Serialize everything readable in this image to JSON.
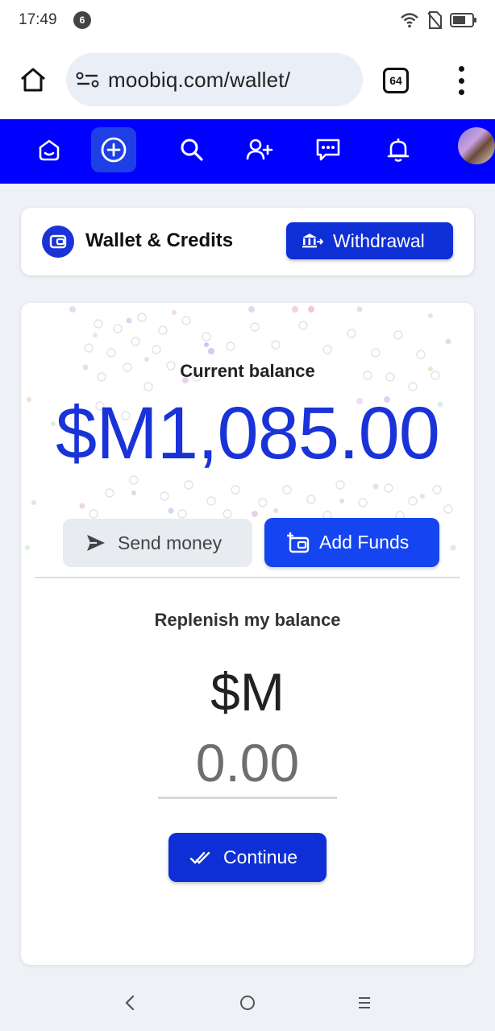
{
  "status": {
    "time": "17:49",
    "notification_count": "6"
  },
  "browser": {
    "url": "moobiq.com/wallet/",
    "tab_count": "64"
  },
  "header": {
    "title": "Wallet & Credits",
    "withdraw_label": "Withdrawal"
  },
  "balance": {
    "label": "Current balance",
    "amount": "$M1,085.00"
  },
  "actions": {
    "send_label": "Send money",
    "add_label": "Add Funds"
  },
  "replenish": {
    "title": "Replenish my balance",
    "currency": "$M",
    "placeholder": "0.00",
    "continue_label": "Continue"
  },
  "colors": {
    "nav_bg": "#0000ff",
    "accent": "#1a33d9",
    "button": "#0e2fd6"
  },
  "icons": {
    "nav": [
      "home-icon",
      "add-circle-icon",
      "search-icon",
      "add-user-icon",
      "messages-icon",
      "bell-icon"
    ],
    "browser": [
      "home-icon",
      "site-settings-icon",
      "menu-dots-icon"
    ]
  }
}
